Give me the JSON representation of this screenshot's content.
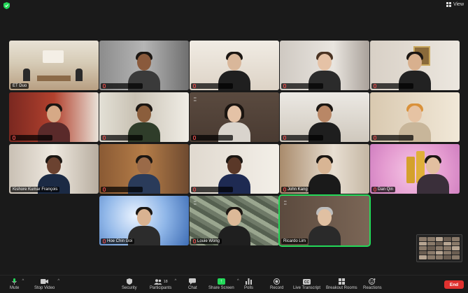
{
  "window": {
    "view_label": "View"
  },
  "participants": [
    {
      "name": "ET Duo"
    },
    {
      "name": ""
    },
    {
      "name": ""
    },
    {
      "name": ""
    },
    {
      "name": ""
    },
    {
      "name": ""
    },
    {
      "name": ""
    },
    {
      "name": ""
    },
    {
      "name": ""
    },
    {
      "name": ""
    },
    {
      "name": "Kishore Kumar François"
    },
    {
      "name": ""
    },
    {
      "name": ""
    },
    {
      "name": "John Kang"
    },
    {
      "name": "Dan Qin"
    },
    {
      "name": "Hoe Chin Goi"
    },
    {
      "name": "Louie Wong"
    },
    {
      "name": "Ricardo Lim"
    }
  ],
  "toolbar": {
    "mute": "Mute",
    "stop_video": "Stop Video",
    "security": "Security",
    "participants": "Participants",
    "participants_count": "18",
    "chat": "Chat",
    "share_screen": "Share Screen",
    "polls": "Polls",
    "record": "Record",
    "live_transcript": "Live Transcript",
    "breakout_rooms": "Breakout Rooms",
    "reactions": "Reactions",
    "end": "End"
  },
  "colors": {
    "active_speaker": "#23d959",
    "end_button": "#e0312f",
    "share_button": "#23d959"
  }
}
